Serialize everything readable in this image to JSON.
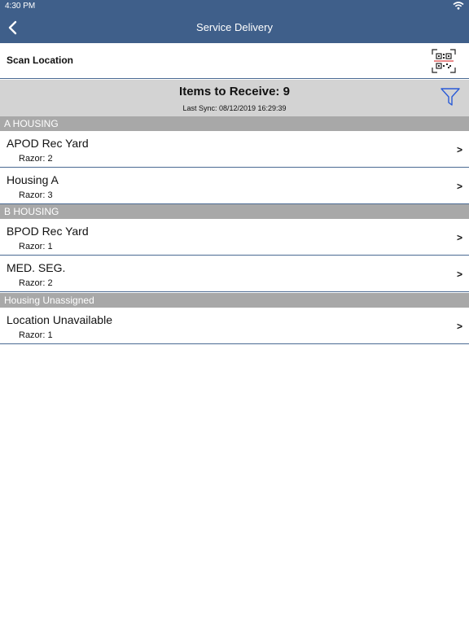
{
  "status_bar": {
    "time": "4:30 PM"
  },
  "nav": {
    "title": "Service Delivery"
  },
  "scan": {
    "label": "Scan Location"
  },
  "summary": {
    "title": "Items to Receive: 9",
    "sync": "Last Sync: 08/12/2019 16:29:39"
  },
  "sections": [
    {
      "header": "A HOUSING",
      "rows": [
        {
          "name": "APOD Rec Yard",
          "detail": "Razor:  2",
          "chevron": ">"
        },
        {
          "name": "Housing A",
          "detail": "Razor:  3",
          "chevron": ">"
        }
      ]
    },
    {
      "header": "B HOUSING",
      "rows": [
        {
          "name": "BPOD Rec Yard",
          "detail": "Razor:  1",
          "chevron": ">"
        },
        {
          "name": "MED. SEG.",
          "detail": "Razor:  2",
          "chevron": ">"
        }
      ]
    },
    {
      "header": "Housing Unassigned",
      "rows": [
        {
          "name": "Location Unavailable",
          "detail": "Razor:  1",
          "chevron": ">"
        }
      ]
    }
  ],
  "icons": [
    "wifi-icon",
    "back-arrow-icon",
    "qr-scan-icon",
    "filter-icon",
    "chevron-right-icon"
  ],
  "colors": {
    "nav_bar": "#3f5f8a",
    "summary_bg": "#d3d3d3",
    "section_bg": "#a8a8a8",
    "filter_icon": "#2a5bd7"
  }
}
